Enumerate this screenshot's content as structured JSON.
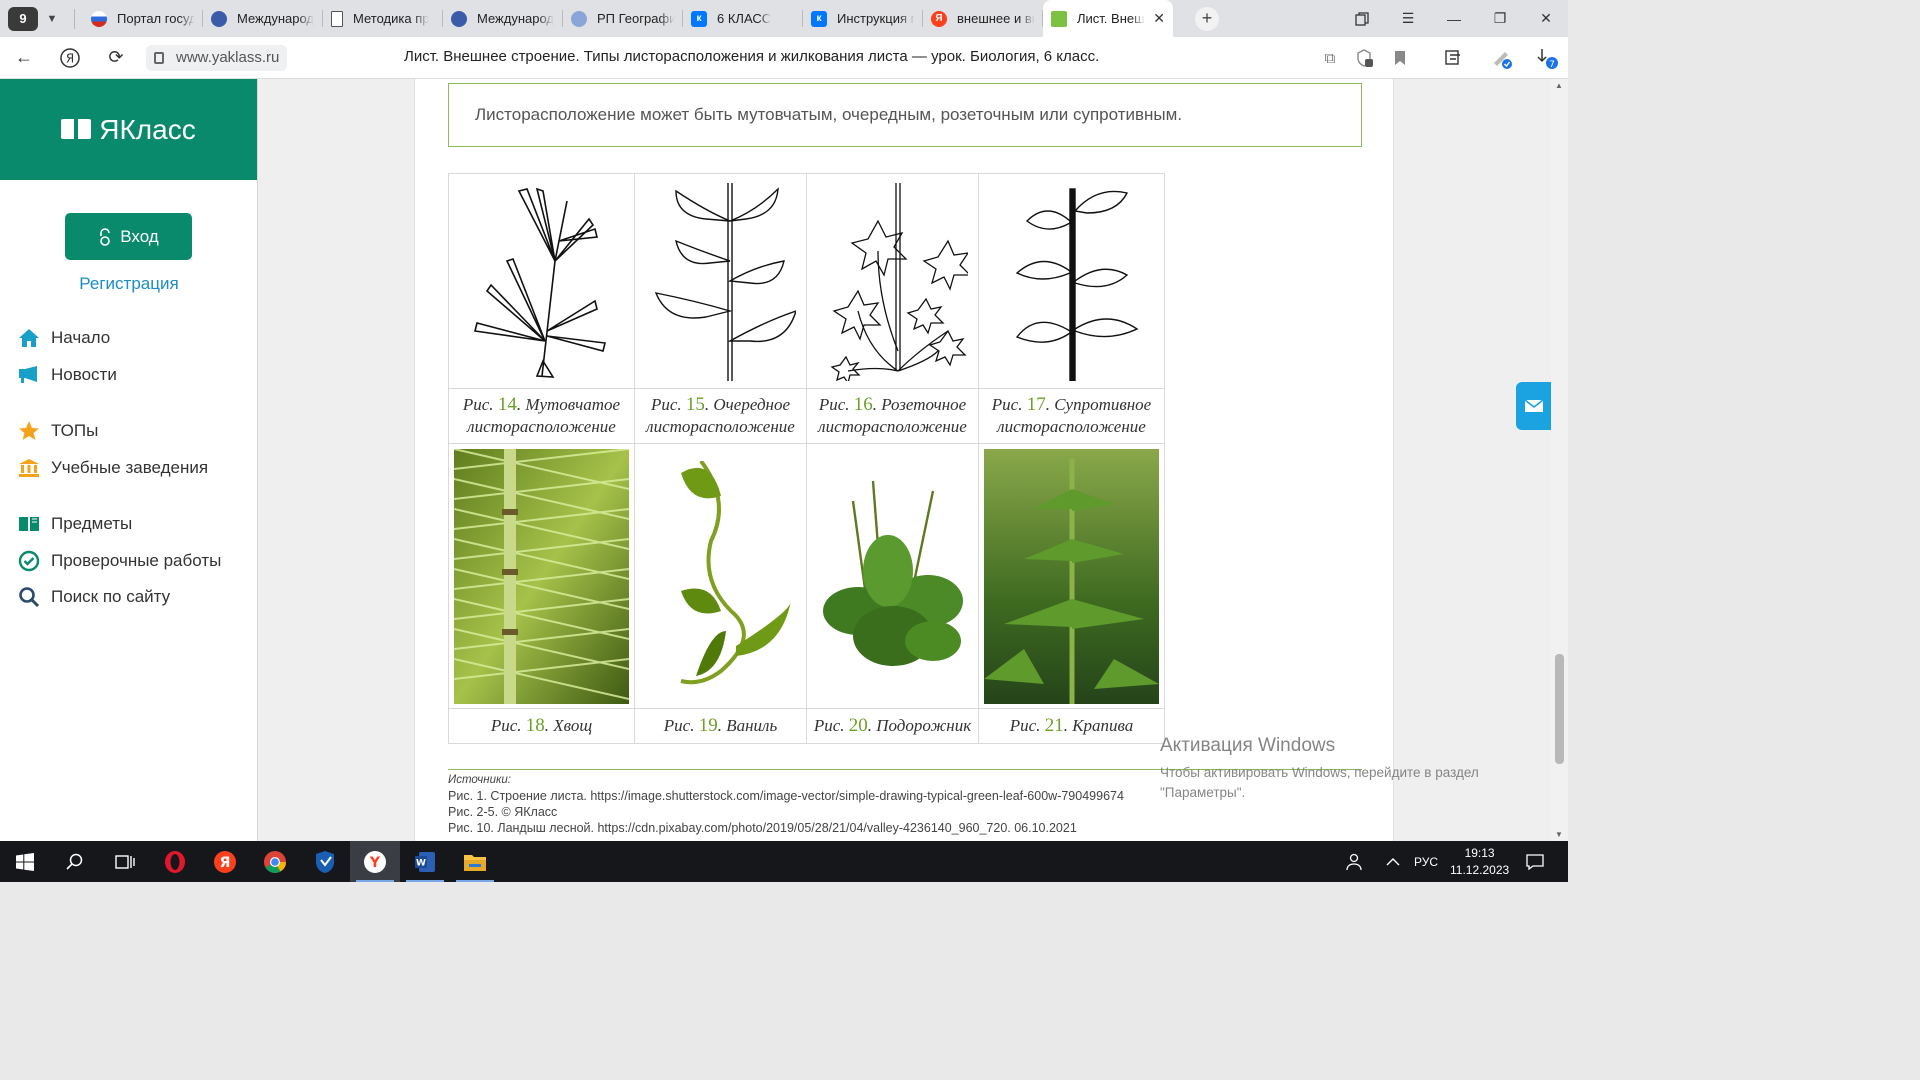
{
  "browser": {
    "tab_count": "9",
    "tabs": [
      {
        "title": "Портал госуда",
        "icon": "russia-flag-icon",
        "color": "#2f6bd8"
      },
      {
        "title": "Международ",
        "icon": "emblem-icon",
        "color": "#3b5ba8"
      },
      {
        "title": "Методика пр",
        "icon": "document-icon",
        "color": "#666666"
      },
      {
        "title": "Международ",
        "icon": "emblem-icon",
        "color": "#3b5ba8"
      },
      {
        "title": "РП География",
        "icon": "emblem-icon",
        "color": "#3b5ba8"
      },
      {
        "title": "6 КЛАСС",
        "icon": "vk-icon",
        "color": "#0077ff"
      },
      {
        "title": "Инструкция п",
        "icon": "vk-icon",
        "color": "#0077ff"
      },
      {
        "title": "внешнее и вн",
        "icon": "yandex-icon",
        "color": "#fc3f1d"
      },
      {
        "title": "Лист. Внеш",
        "icon": "yaklass-icon",
        "color": "#7cc142",
        "active": true
      }
    ],
    "url": "www.yaklass.ru",
    "page_title": "Лист. Внешнее строение. Типы листорасположения и жилкования листа — урок. Биология, 6 класс.",
    "downloads_badge": "7"
  },
  "sidebar": {
    "logo": "ЯКласс",
    "login_label": "Вход",
    "register_label": "Регистрация",
    "items": [
      {
        "label": "Начало",
        "icon": "home-icon"
      },
      {
        "label": "Новости",
        "icon": "news-icon"
      },
      {
        "label": "ТОПы",
        "icon": "star-icon"
      },
      {
        "label": "Учебные заведения",
        "icon": "institution-icon"
      },
      {
        "label": "Предметы",
        "icon": "book-icon"
      },
      {
        "label": "Проверочные работы",
        "icon": "check-circle-icon"
      },
      {
        "label": "Поиск по сайту",
        "icon": "search-icon"
      }
    ]
  },
  "content": {
    "note": "Листорасположение может быть мутовчатым, очередным, розеточным или супротивным.",
    "figures_row1": [
      {
        "prefix": "Рис. ",
        "num": "14",
        "text": ". Мутовчатое",
        "line2": "листорасположение"
      },
      {
        "prefix": "Рис. ",
        "num": "15",
        "text": ". Очередное",
        "line2": "листорасположение"
      },
      {
        "prefix": "Рис. ",
        "num": "16",
        "text": ". Розеточное",
        "line2": "листорасположение"
      },
      {
        "prefix": "Рис. ",
        "num": "17",
        "text": ". Супротивное",
        "line2": "листорасположение"
      }
    ],
    "figures_row2": [
      {
        "prefix": "Рис. ",
        "num": "18",
        "text": ". Хвощ"
      },
      {
        "prefix": "Рис. ",
        "num": "19",
        "text": ". Ваниль"
      },
      {
        "prefix": "Рис. ",
        "num": "20",
        "text": ". Подорожник"
      },
      {
        "prefix": "Рис. ",
        "num": "21",
        "text": ". Крапива"
      }
    ],
    "sources_header": "Источники:",
    "sources": [
      "Рис. 1. Строение листа. https://image.shutterstock.com/image-vector/simple-drawing-typical-green-leaf-600w-790499674",
      "Рис. 2-5. © ЯКласс",
      "Рис. 10. Ландыш лесной. https://cdn.pixabay.com/photo/2019/05/28/21/04/valley-4236140_960_720. 06.10.2021"
    ]
  },
  "activation": {
    "title": "Активация Windows",
    "line1": "Чтобы активировать Windows, перейдите в раздел",
    "line2": "\"Параметры\"."
  },
  "taskbar": {
    "lang": "РУС",
    "time": "19:13",
    "date": "11.12.2023"
  }
}
